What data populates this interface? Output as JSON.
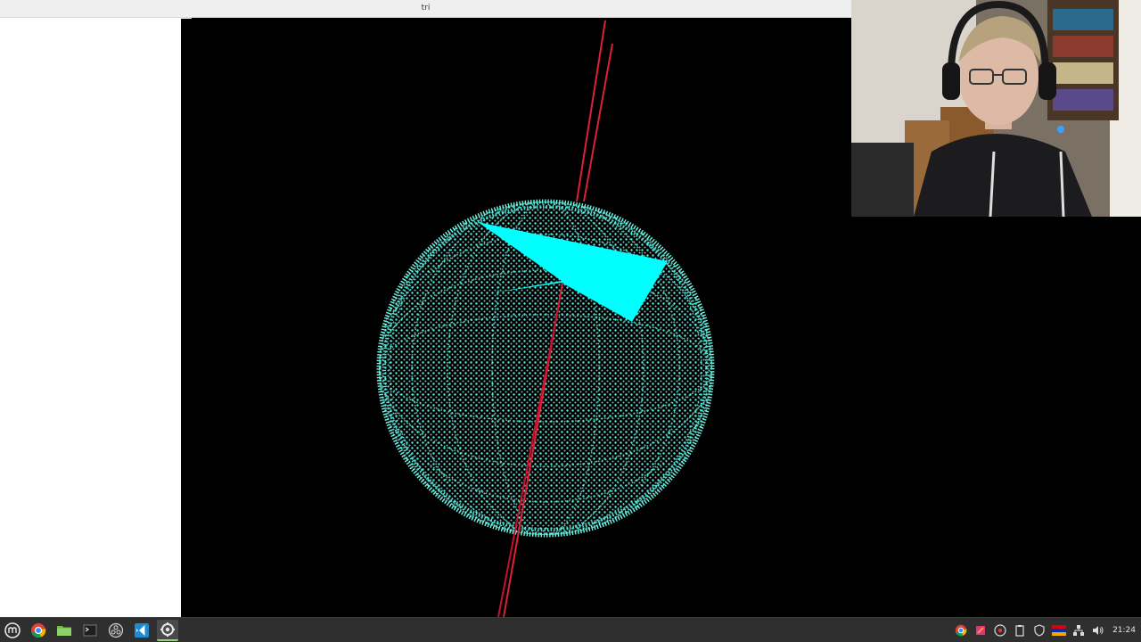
{
  "window": {
    "title": "tri"
  },
  "scene": {
    "background": "#000000",
    "sphere_color": "#40e0d0",
    "shape_color": "#00ffff",
    "ray_color": "#e0203a"
  },
  "taskbar": {
    "launchers": [
      {
        "icon": "mint-menu-icon",
        "name": "menu"
      },
      {
        "icon": "chrome-icon",
        "name": "chrome"
      },
      {
        "icon": "files-folder-icon",
        "name": "files"
      },
      {
        "icon": "terminal-icon",
        "name": "terminal"
      },
      {
        "icon": "obs-icon",
        "name": "obs"
      },
      {
        "icon": "vscode-icon",
        "name": "vscode"
      },
      {
        "icon": "tri-app-icon",
        "name": "tri"
      }
    ],
    "tray_icons": [
      "chrome-tray-icon",
      "app-tray-icon",
      "obs-tray-icon",
      "clipboard-icon",
      "shield-icon",
      "flag-icon",
      "network-icon",
      "volume-icon"
    ],
    "clock": "21:24"
  }
}
